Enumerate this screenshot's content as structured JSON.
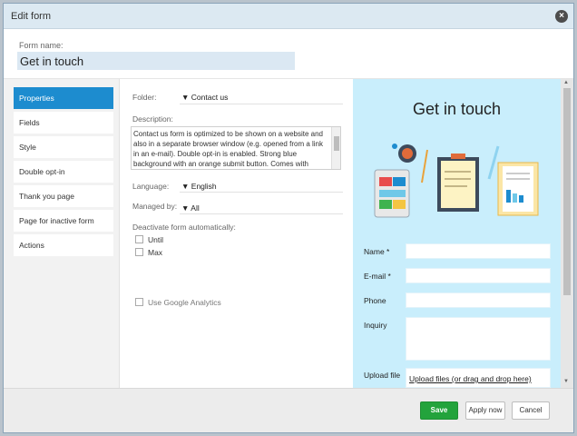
{
  "window": {
    "title": "Edit form"
  },
  "form_name": {
    "label": "Form name:",
    "value": "Get in touch"
  },
  "sidebar": {
    "items": [
      {
        "label": "Properties",
        "active": true
      },
      {
        "label": "Fields"
      },
      {
        "label": "Style"
      },
      {
        "label": "Double opt-in"
      },
      {
        "label": "Thank you page"
      },
      {
        "label": "Page for inactive form"
      },
      {
        "label": "Actions"
      }
    ]
  },
  "properties": {
    "folder_label": "Folder:",
    "folder_value": "▼ Contact us",
    "description_label": "Description:",
    "description_text": "Contact us form is optimized to be shown on a website and also in a separate browser window (e.g. opened from a link in an e-mail). Double opt-in is enabled. Strong blue background with an orange submit button. Comes with",
    "language_label": "Language:",
    "language_value": "▼ English",
    "managed_label": "Managed by:",
    "managed_value": "▼ All",
    "deactivate_label": "Deactivate form automatically:",
    "until_label": "Until",
    "max_label": "Max",
    "ga_label": "Use Google Analytics"
  },
  "preview": {
    "title": "Get in touch",
    "fields": [
      {
        "label": "Name *"
      },
      {
        "label": "E-mail *"
      },
      {
        "label": "Phone"
      },
      {
        "label": "Inquiry"
      },
      {
        "label": "Upload file"
      }
    ],
    "upload_link": "Upload files (or drag and drop here)"
  },
  "footer": {
    "save_label": "Save",
    "apply_label": "Apply now",
    "cancel_label": "Cancel"
  },
  "colors": {
    "accent": "#1d8ccf",
    "save": "#23a33c",
    "preview_bg": "#c9eefc"
  }
}
